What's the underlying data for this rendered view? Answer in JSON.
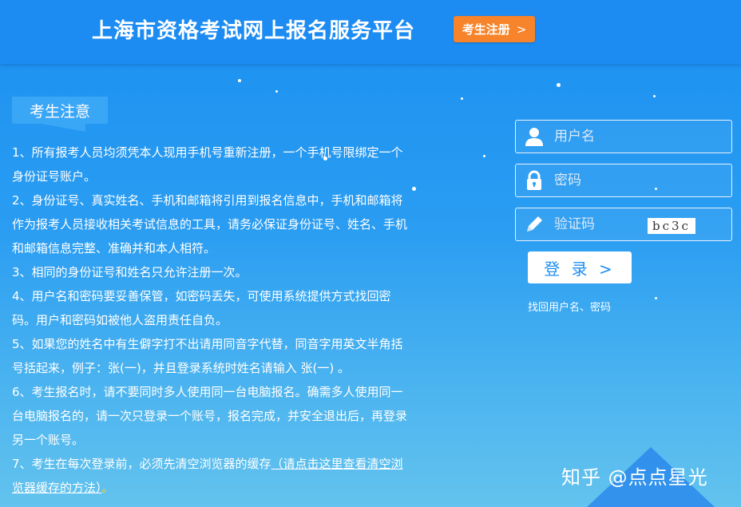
{
  "header": {
    "title": "上海市资格考试网上报名服务平台",
    "register_label": "考生注册",
    "register_chevron": ">"
  },
  "notice": {
    "heading": "考生注意",
    "items": [
      "1、所有报考人员均须凭本人现用手机号重新注册，一个手机号限绑定一个身份证号账户。",
      "2、身份证号、真实姓名、手机和邮箱将引用到报名信息中，手机和邮箱将作为报考人员接收相关考试信息的工具，请务必保证身份证号、姓名、手机和邮箱信息完整、准确并和本人相符。",
      "3、相同的身份证号和姓名只允许注册一次。",
      "4、用户名和密码要妥善保管，如密码丢失，可使用系统提供方式找回密码。用户和密码如被他人盗用责任自负。",
      "5、如果您的姓名中有生僻字打不出请用同音字代替，同音字用英文半角括号括起来，例子：张(一)，并且登录系统时姓名请输入 张(一) 。",
      "6、考生报名时，请不要同时多人使用同一台电脑报名。确需多人使用同一台电脑报名的，请一次只登录一个账号，报名完成，并安全退出后，再登录另一个账号。"
    ],
    "item7_prefix": "7、考生在每次登录前，必须先清空浏览器的缓存",
    "item7_link": "（请点击这里查看清空浏览器缓存的方法）",
    "item7_suffix": "。"
  },
  "login": {
    "username_placeholder": "用户名",
    "password_placeholder": "密码",
    "captcha_placeholder": "验证码",
    "captcha_text": "bc3c",
    "login_label": "登 录 >",
    "recover_label": "找回用户名、密码"
  },
  "watermark": "知乎 @点点星光",
  "colors": {
    "header_bg": "#1c8cf2",
    "accent_orange": "#f7832a",
    "login_text": "#1e8ef0"
  }
}
